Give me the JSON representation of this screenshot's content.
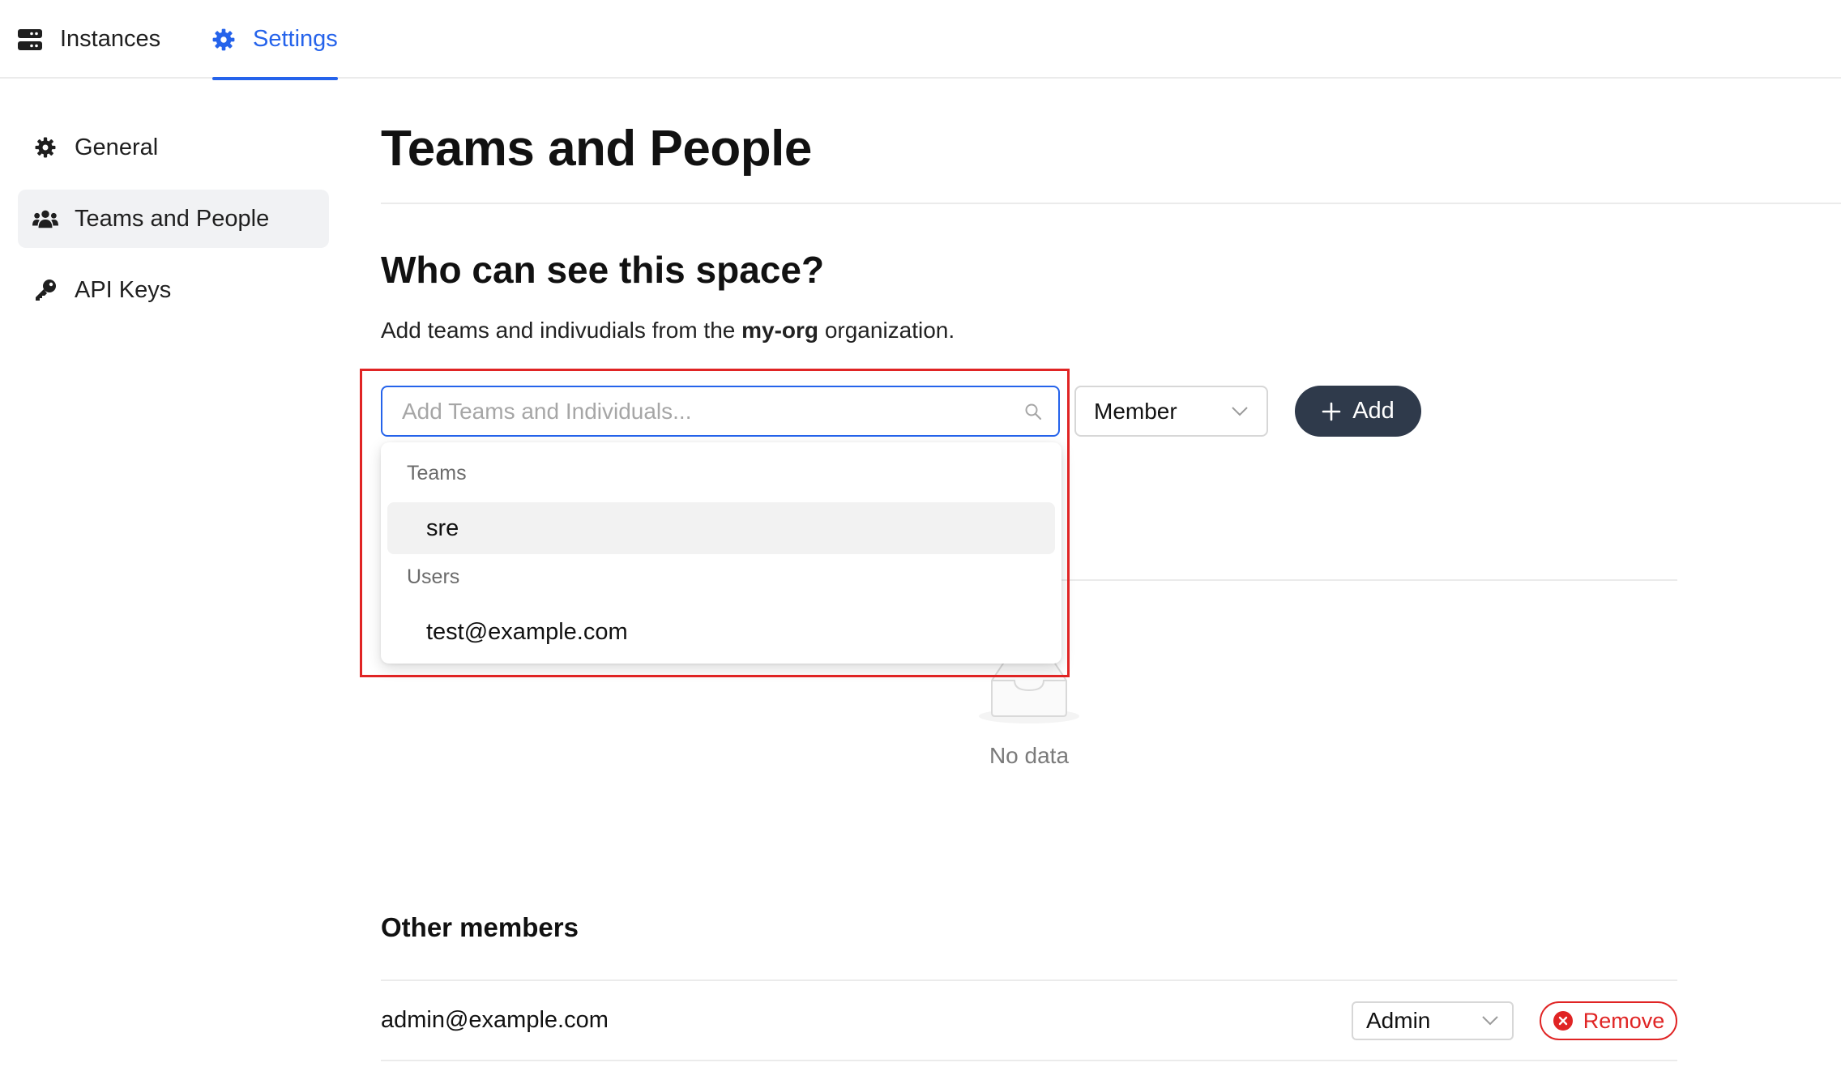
{
  "top_nav": {
    "tabs": [
      {
        "label": "Instances",
        "icon": "server-icon",
        "active": false
      },
      {
        "label": "Settings",
        "icon": "gear-icon",
        "active": true
      }
    ]
  },
  "sidebar": {
    "items": [
      {
        "label": "General",
        "icon": "gear-icon",
        "active": false
      },
      {
        "label": "Teams and People",
        "icon": "users-icon",
        "active": true
      },
      {
        "label": "API Keys",
        "icon": "key-icon",
        "active": false
      }
    ]
  },
  "main": {
    "title": "Teams and People",
    "section_title": "Who can see this space?",
    "description_prefix": "Add teams and indivudials from the",
    "description_org": "my-org",
    "description_suffix": "organization.",
    "search": {
      "placeholder": "Add Teams and Individuals...",
      "value": ""
    },
    "role_select": {
      "value": "Member"
    },
    "add_label": "Add",
    "dropdown": {
      "groups": [
        {
          "label": "Teams",
          "options": [
            "sre"
          ]
        },
        {
          "label": "Users",
          "options": [
            "test@example.com"
          ]
        }
      ]
    },
    "empty_text": "No data",
    "other_members_title": "Other members",
    "other_members": [
      {
        "email": "admin@example.com",
        "role": "Admin",
        "remove_label": "Remove"
      }
    ]
  },
  "colors": {
    "accent": "#2563eb",
    "primary_button": "#2f3a4b",
    "danger": "#e02424",
    "sidebar_active_bg": "#f1f2f4"
  }
}
